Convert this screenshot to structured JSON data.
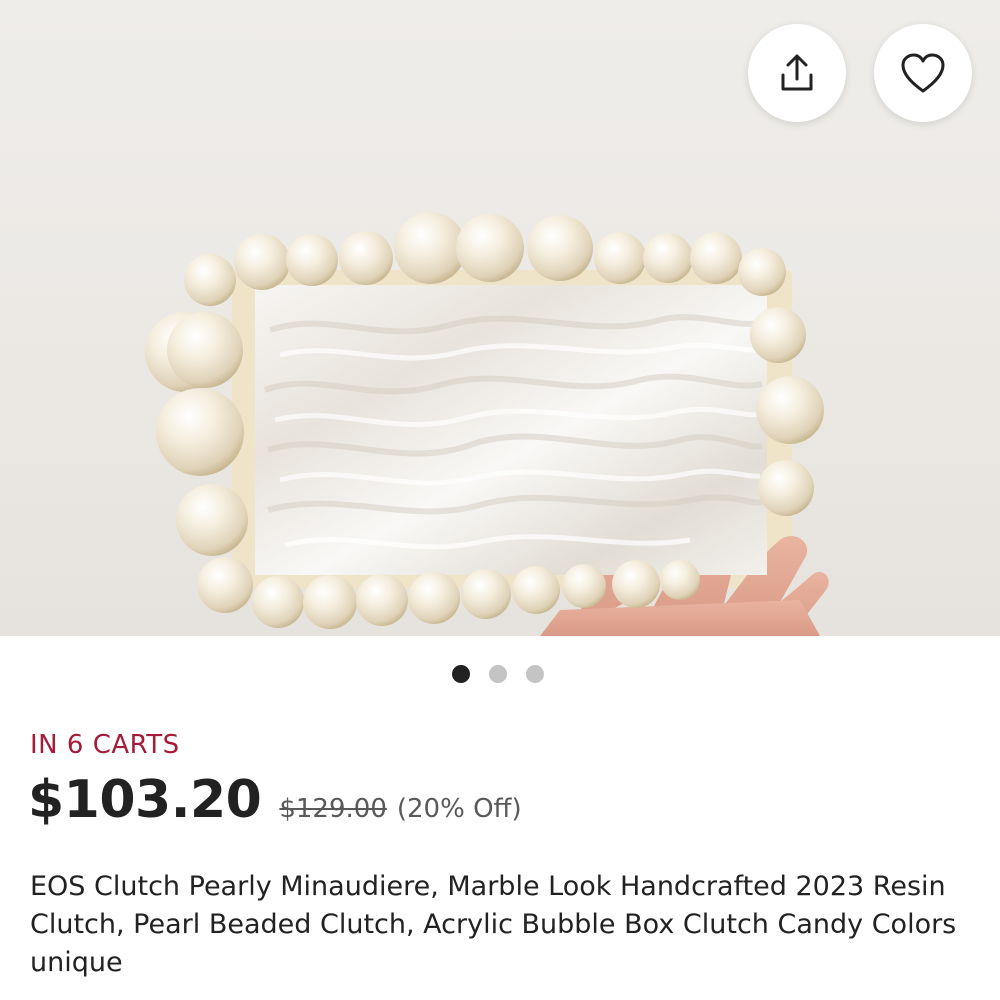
{
  "product": {
    "image_alt": "Pearl beaded marble acrylic clutch held in hand",
    "carousel": {
      "total": 3,
      "active_index": 0
    },
    "in_carts": "IN 6 CARTS",
    "price": "$103.20",
    "original_price": "$129.00",
    "discount": "(20% Off)",
    "title": "EOS Clutch Pearly Minaudiere, Marble Look Handcrafted 2023 Resin Clutch, Pearl Beaded Clutch, Acrylic Bubble Box Clutch Candy Colors unique"
  },
  "actions": {
    "share_icon": "share-icon",
    "favorite_icon": "heart-icon"
  },
  "colors": {
    "carts_accent": "#a61a3a",
    "dot_active": "#222222",
    "dot_inactive": "#c4c4c4"
  }
}
